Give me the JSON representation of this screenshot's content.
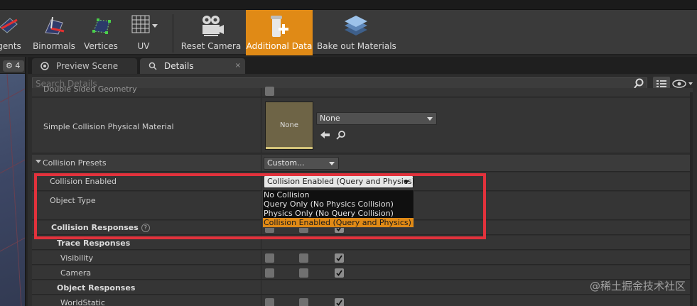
{
  "toolbar": {
    "buttons": [
      {
        "label": "gents",
        "icon": "tangents-icon",
        "active": false
      },
      {
        "label": "Binormals",
        "icon": "binormals-icon",
        "active": false
      },
      {
        "label": "Vertices",
        "icon": "vertices-icon",
        "active": false
      },
      {
        "label": "UV",
        "icon": "uv-grid-icon",
        "active": false
      },
      {
        "label": "Reset Camera",
        "icon": "camera-icon",
        "active": false
      },
      {
        "label": "Additional Data",
        "icon": "additional-data-icon",
        "active": true
      },
      {
        "label": "Bake out Materials",
        "icon": "bake-materials-icon",
        "active": false
      }
    ],
    "accent": "#e08a16"
  },
  "viewport": {
    "chip_value": "4"
  },
  "tabs": [
    {
      "label": "Preview Scene Sett",
      "active": false
    },
    {
      "label": "Details",
      "active": true,
      "close": "×"
    }
  ],
  "search": {
    "placeholder": "Search Details"
  },
  "details": {
    "cut_row_label": "Double Sided Geometry",
    "phys_material": {
      "label": "Simple Collision Physical Material",
      "thumb_label": "None",
      "value": "None"
    },
    "presets": {
      "label": "Collision Presets",
      "value": "Custom..."
    },
    "collision_enabled": {
      "label": "Collision Enabled",
      "value": "Collision Enabled (Query and Physics)"
    },
    "object_type": {
      "label": "Object Type"
    },
    "responses": {
      "label": "Collision Responses",
      "help": "?"
    },
    "trace_responses": {
      "label": "Trace Responses"
    },
    "visibility": {
      "label": "Visibility",
      "checks": [
        false,
        false,
        true
      ]
    },
    "camera": {
      "label": "Camera",
      "checks": [
        false,
        false,
        true
      ]
    },
    "object_responses": {
      "label": "Object Responses"
    },
    "world_static": {
      "label": "WorldStatic",
      "checks": [
        false,
        false,
        true
      ]
    }
  },
  "dropdown": {
    "options": [
      {
        "label": "No Collision",
        "selected": false
      },
      {
        "label": "Query Only (No Physics Collision)",
        "selected": false
      },
      {
        "label": "Physics Only (No Query Collision)",
        "selected": false
      },
      {
        "label": "Collision Enabled (Query and Physics)",
        "selected": true
      }
    ]
  },
  "colors": {
    "highlight_box": "#e2323c",
    "selected_option": "#e08a16"
  },
  "watermark": "@稀土掘金技术社区"
}
